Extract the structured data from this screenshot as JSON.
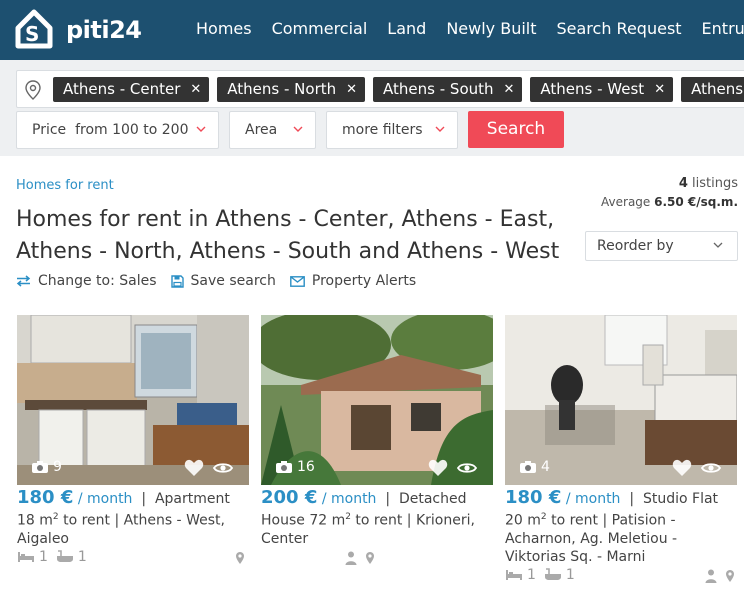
{
  "header": {
    "logo_text": "piti24",
    "nav": [
      "Homes",
      "Commercial",
      "Land",
      "Newly Built",
      "Search Request",
      "Entrust"
    ]
  },
  "search": {
    "location_chips": [
      "Athens - Center",
      "Athens - North",
      "Athens - South",
      "Athens - West",
      "Athens - East"
    ],
    "price_label": "Price",
    "price_value": "from 100 to 200",
    "area_label": "Area",
    "more_filters_label": "more filters",
    "search_button": "Search"
  },
  "results": {
    "breadcrumb": "Homes for rent",
    "count_number": "4",
    "count_label": "listings",
    "average_label": "Average",
    "average_value": "6.50 €/sq.m.",
    "title": "Homes for rent in Athens - Center, Athens - East, Athens - North, Athens - South and Athens - West",
    "reorder_label": "Reorder by",
    "change_to": "Change to: Sales",
    "save_search": "Save search",
    "alerts": "Property Alerts"
  },
  "listings": [
    {
      "photos": "9",
      "price": "180 €",
      "per": "/ month",
      "summary_start": "Apartment 18 m",
      "sup": "2",
      "summary_end": " to rent  |  Athens - West, Aigaleo",
      "bedrooms": "1",
      "bathrooms": "1"
    },
    {
      "photos": "16",
      "price": "200 €",
      "per": "/ month",
      "summary_start": "Detached House 72 m",
      "sup": "2",
      "summary_end": " to rent  |  Krioneri, Center",
      "bedrooms": "",
      "bathrooms": ""
    },
    {
      "photos": "4",
      "price": "180 €",
      "per": "/ month",
      "summary_start": "Studio Flat 20 m",
      "sup": "2",
      "summary_end": " to rent  |  Patision - Acharnon, Ag. Meletiou - Viktorias Sq. - Marni",
      "bedrooms": "1",
      "bathrooms": "1"
    }
  ],
  "colors": {
    "header_bg": "#1d5070",
    "accent_blue": "#2b8fc5",
    "search_button": "#f04a57",
    "chip_bg": "#333333"
  }
}
